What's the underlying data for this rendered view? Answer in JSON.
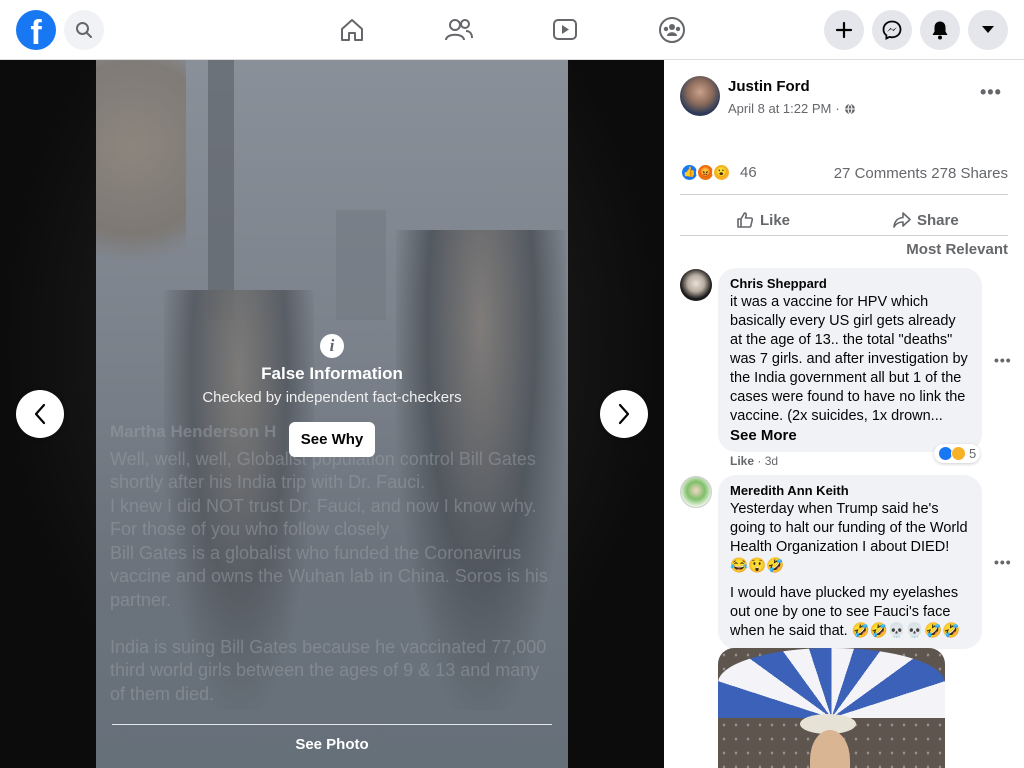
{
  "colors": {
    "brand": "#1877f2",
    "text_secondary": "#65676b",
    "bubble_bg": "#f0f2f5"
  },
  "topbar": {
    "logo_letter": "f",
    "icons": [
      "search-icon",
      "home-icon",
      "friends-icon",
      "watch-icon",
      "groups-icon",
      "plus-icon",
      "messenger-icon",
      "notifications-icon",
      "menu-caret-icon"
    ]
  },
  "viewer": {
    "overlay_author": "Martha Henderson H",
    "overlay_text": "Well, well, well, Globalist population control Bill Gates shortly after his India trip with Dr. Fauci.\n I knew I did NOT trust Dr. Fauci, and now I know why.\nFor those of you who follow closely\nBill Gates is a globalist who funded the Coronavirus vaccine and owns the Wuhan lab in China. Soros is his partner.\n\nIndia is suing Bill Gates because he vaccinated 77,000 third world girls between the ages of 9 & 13 and many of them died.",
    "fact_check": {
      "title": "False Information",
      "subtitle": "Checked by independent fact-checkers",
      "button": "See Why"
    },
    "see_photo": "See Photo"
  },
  "post": {
    "author": "Justin Ford",
    "timestamp": "April 8 at 1:22 PM",
    "separator": "·",
    "reaction_count": "46",
    "comments_count": "27 Comments",
    "shares_count": "278 Shares",
    "like_label": "Like",
    "share_label": "Share",
    "sort_label": "Most Relevant"
  },
  "comments": [
    {
      "name": "Chris Sheppard",
      "text": "it was a vaccine for HPV which basically every US girl gets already at the age of 13.. the total \"deaths\" was 7 girls. and after investigation by the India government all but 1 of the cases were found to have no link the vaccine. (2x suicides, 1x drown...",
      "see_more": "See More",
      "like_label": "Like",
      "time": "3d",
      "reaction_count": "5"
    },
    {
      "name": "Meredith Ann Keith",
      "text": "Yesterday when Trump said he's going to halt our funding of the World Health Organization I about DIED! 😂😲🤣",
      "text2": "I would have plucked my eyelashes out one by one to see Fauci's face when he said that. 🤣🤣💀💀🤣🤣"
    }
  ]
}
